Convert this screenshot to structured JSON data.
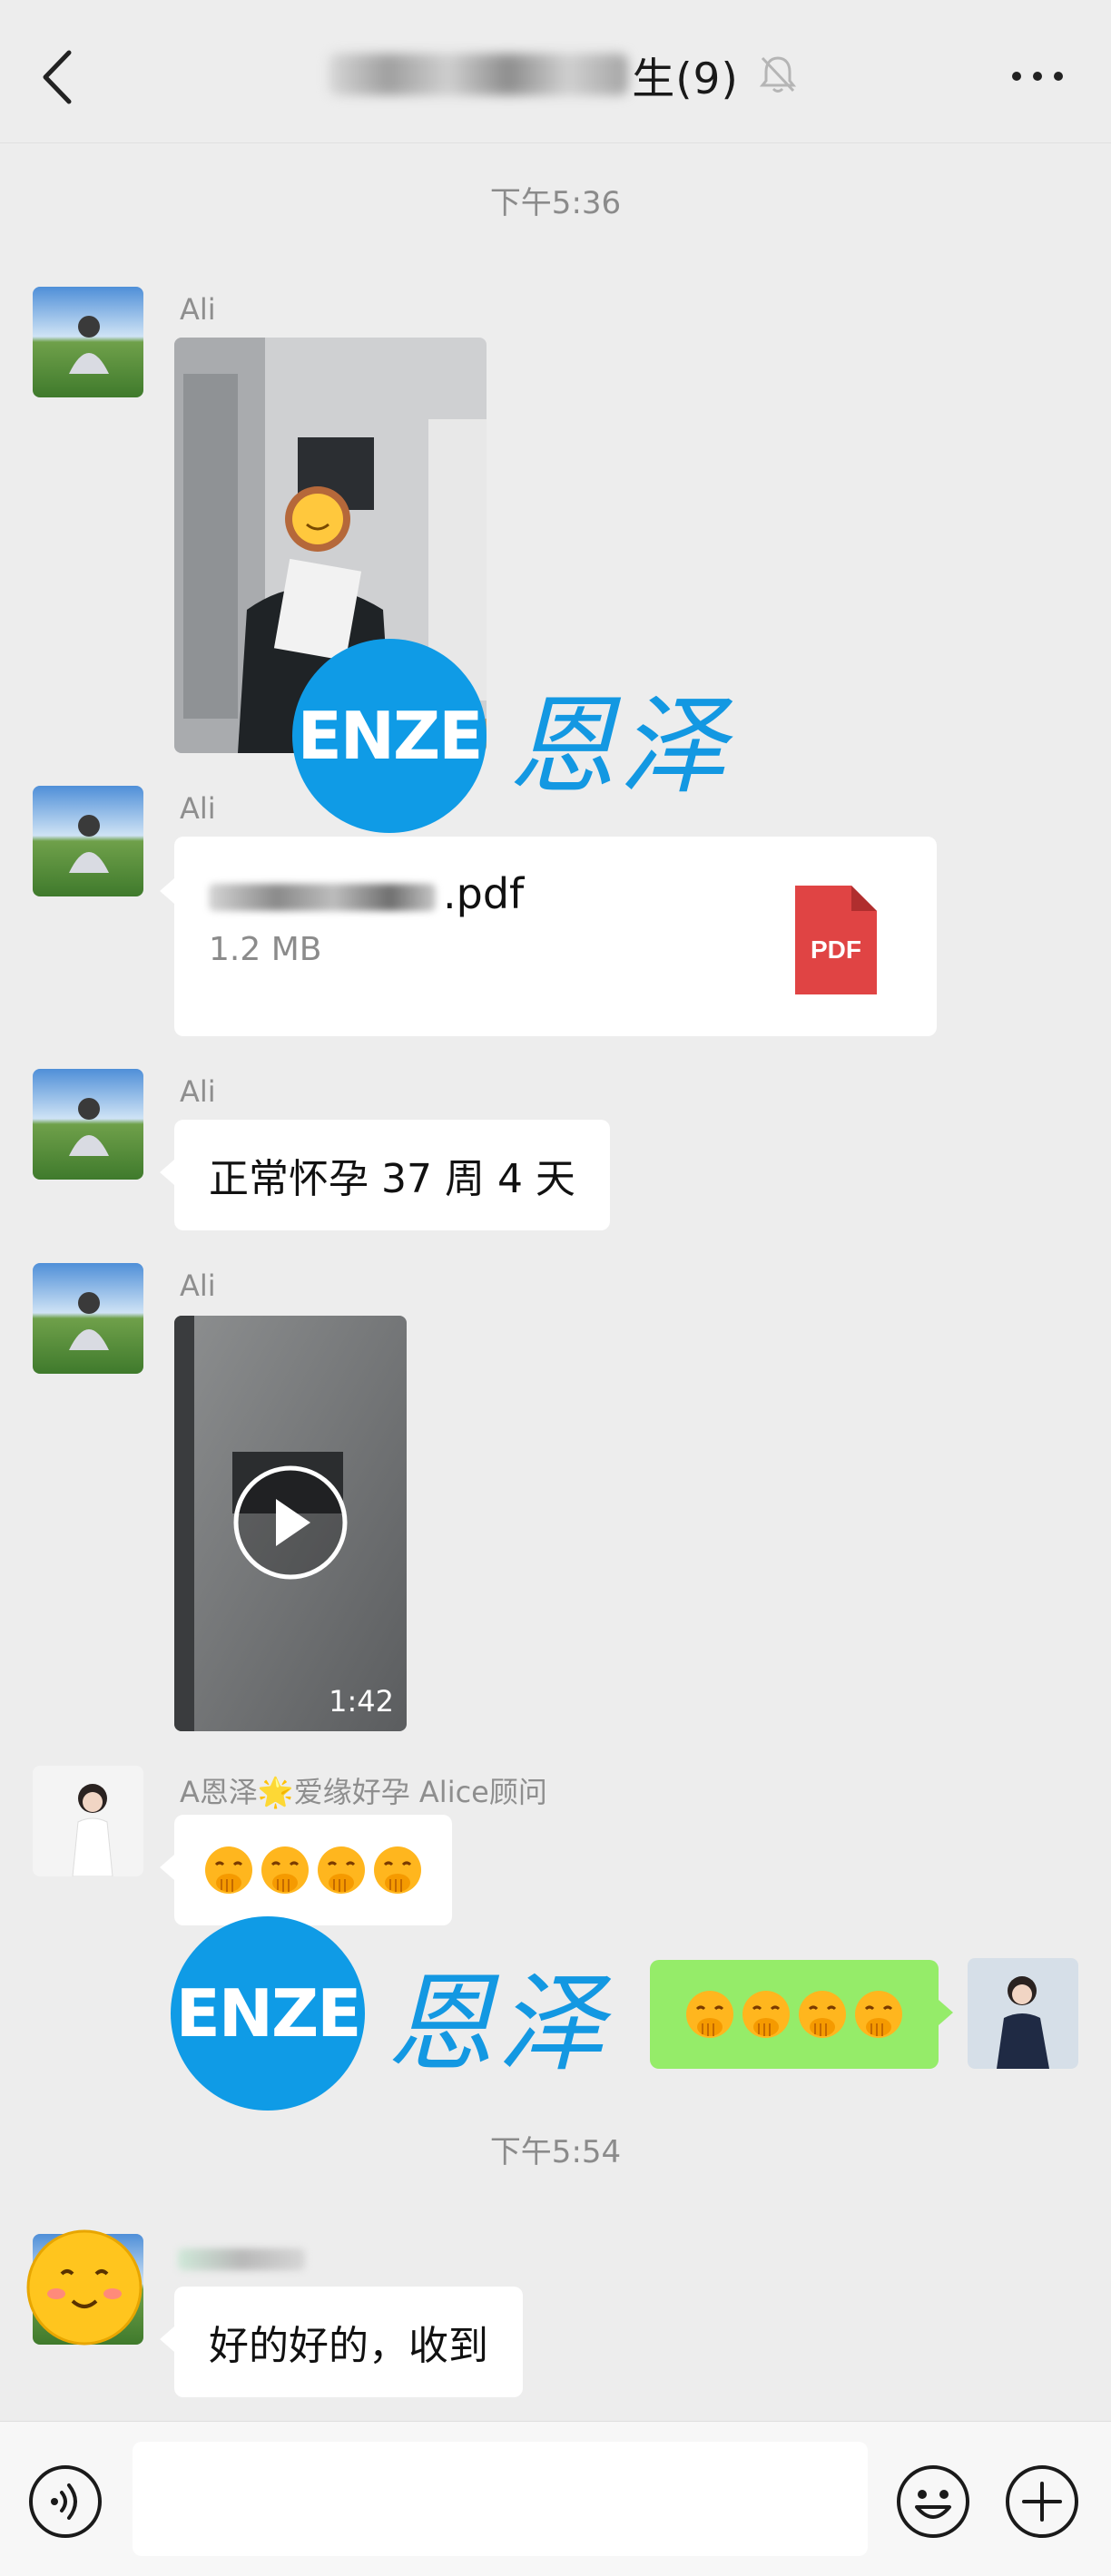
{
  "header": {
    "title_suffix": "生(9)",
    "back_icon": "chevron-left-icon",
    "mute_icon": "bell-off-icon",
    "more_icon": "more-dots-icon"
  },
  "timestamps": [
    "下午5:36",
    "下午5:54"
  ],
  "messages": [
    {
      "sender": "Ali",
      "type": "image"
    },
    {
      "sender": "Ali",
      "type": "file",
      "file_ext": ".pdf",
      "file_size": "1.2 MB",
      "file_icon_label": "PDF"
    },
    {
      "sender": "Ali",
      "type": "text",
      "text": "正常怀孕 37 周 4 天"
    },
    {
      "sender": "Ali",
      "type": "video",
      "duration": "1:42"
    },
    {
      "sender": "A恩泽🌟爱缘好孕 Alice顾问",
      "type": "emoji",
      "emoji_count": 4
    },
    {
      "sender": "me",
      "type": "emoji",
      "emoji_count": 4
    },
    {
      "sender": "",
      "type": "text",
      "text": "好的好的，收到"
    }
  ],
  "watermark": {
    "logo_text": "ENZE",
    "chinese_text": "恩泽"
  },
  "input_bar": {
    "placeholder": "",
    "voice_icon": "voice-icon",
    "emoji_icon": "smiley-icon",
    "plus_icon": "plus-icon"
  },
  "colors": {
    "background": "#ededed",
    "bubble_incoming": "#ffffff",
    "bubble_outgoing": "#95ec69",
    "watermark_blue": "#0f9be6",
    "pdf_red": "#e04444"
  }
}
